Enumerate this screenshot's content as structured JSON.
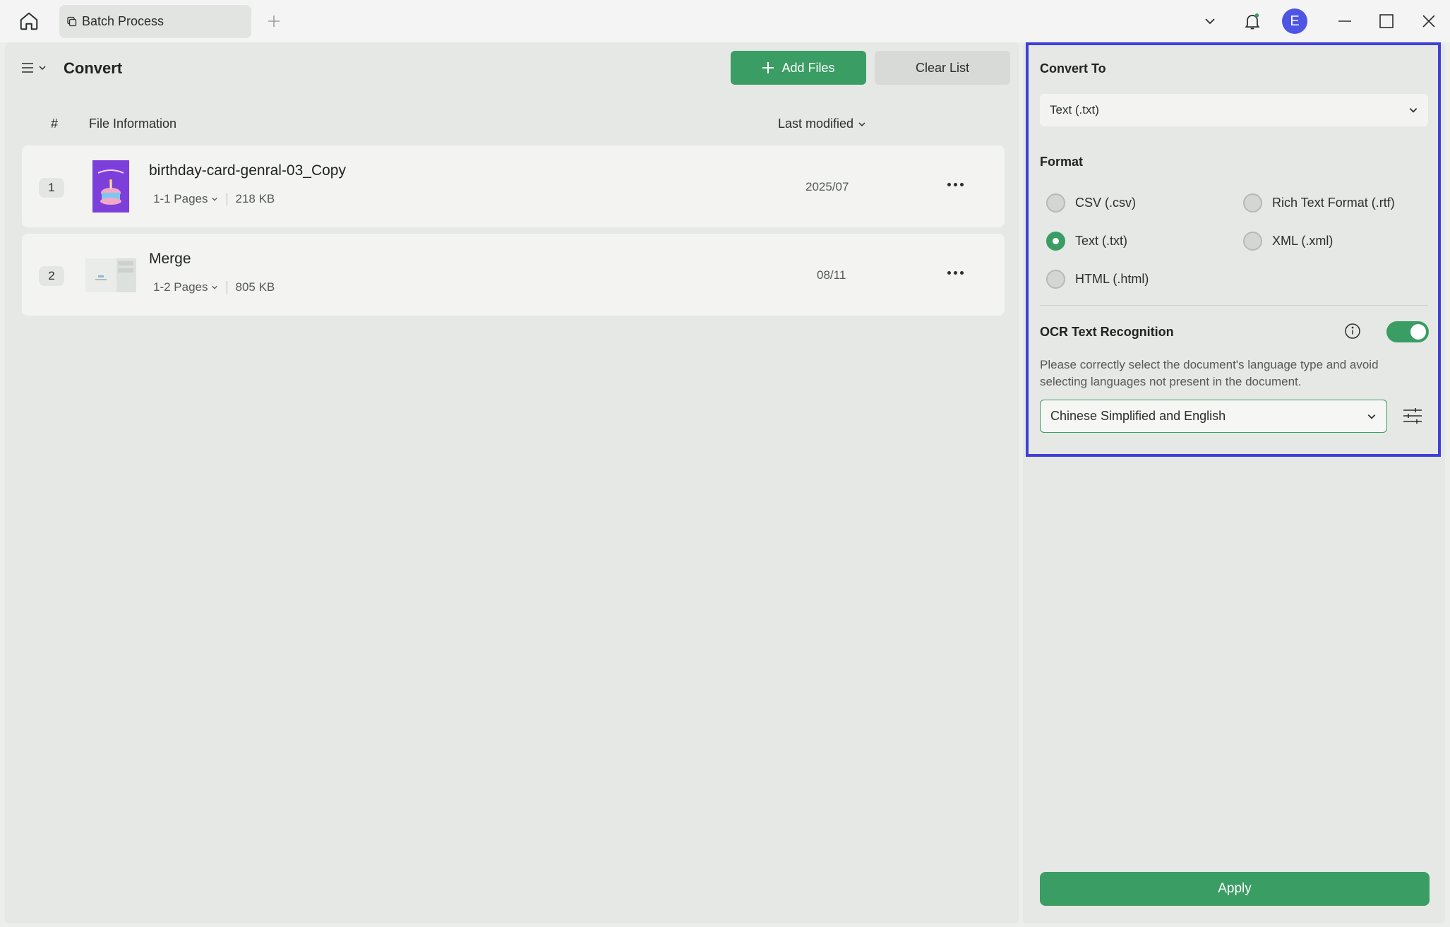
{
  "titlebar": {
    "tab_label": "Batch Process",
    "avatar_initial": "E"
  },
  "toolbar": {
    "title": "Convert",
    "add_files_label": "Add Files",
    "clear_list_label": "Clear List"
  },
  "table": {
    "col_num": "#",
    "col_info": "File Information",
    "col_modified": "Last modified"
  },
  "files": [
    {
      "num": "1",
      "name": "birthday-card-genral-03_Copy",
      "pages": "1-1 Pages",
      "size": "218 KB",
      "date": "2025/07"
    },
    {
      "num": "2",
      "name": "Merge",
      "pages": "1-2 Pages",
      "size": "805 KB",
      "date": "08/11"
    }
  ],
  "settings": {
    "convert_to_label": "Convert To",
    "convert_to_value": "Text (.txt)",
    "format_label": "Format",
    "formats": [
      {
        "label": "CSV (.csv)",
        "checked": false
      },
      {
        "label": "Rich Text Format (.rtf)",
        "checked": false
      },
      {
        "label": "Text (.txt)",
        "checked": true
      },
      {
        "label": "XML (.xml)",
        "checked": false
      },
      {
        "label": "HTML (.html)",
        "checked": false
      }
    ],
    "ocr_label": "OCR Text Recognition",
    "ocr_enabled": true,
    "ocr_desc": "Please correctly select the document's language type and avoid selecting languages not present in the document.",
    "language_value": "Chinese Simplified and English",
    "apply_label": "Apply"
  },
  "colors": {
    "accent": "#3a9d64",
    "highlight": "#3f3fd8",
    "avatar": "#4f55e3"
  }
}
